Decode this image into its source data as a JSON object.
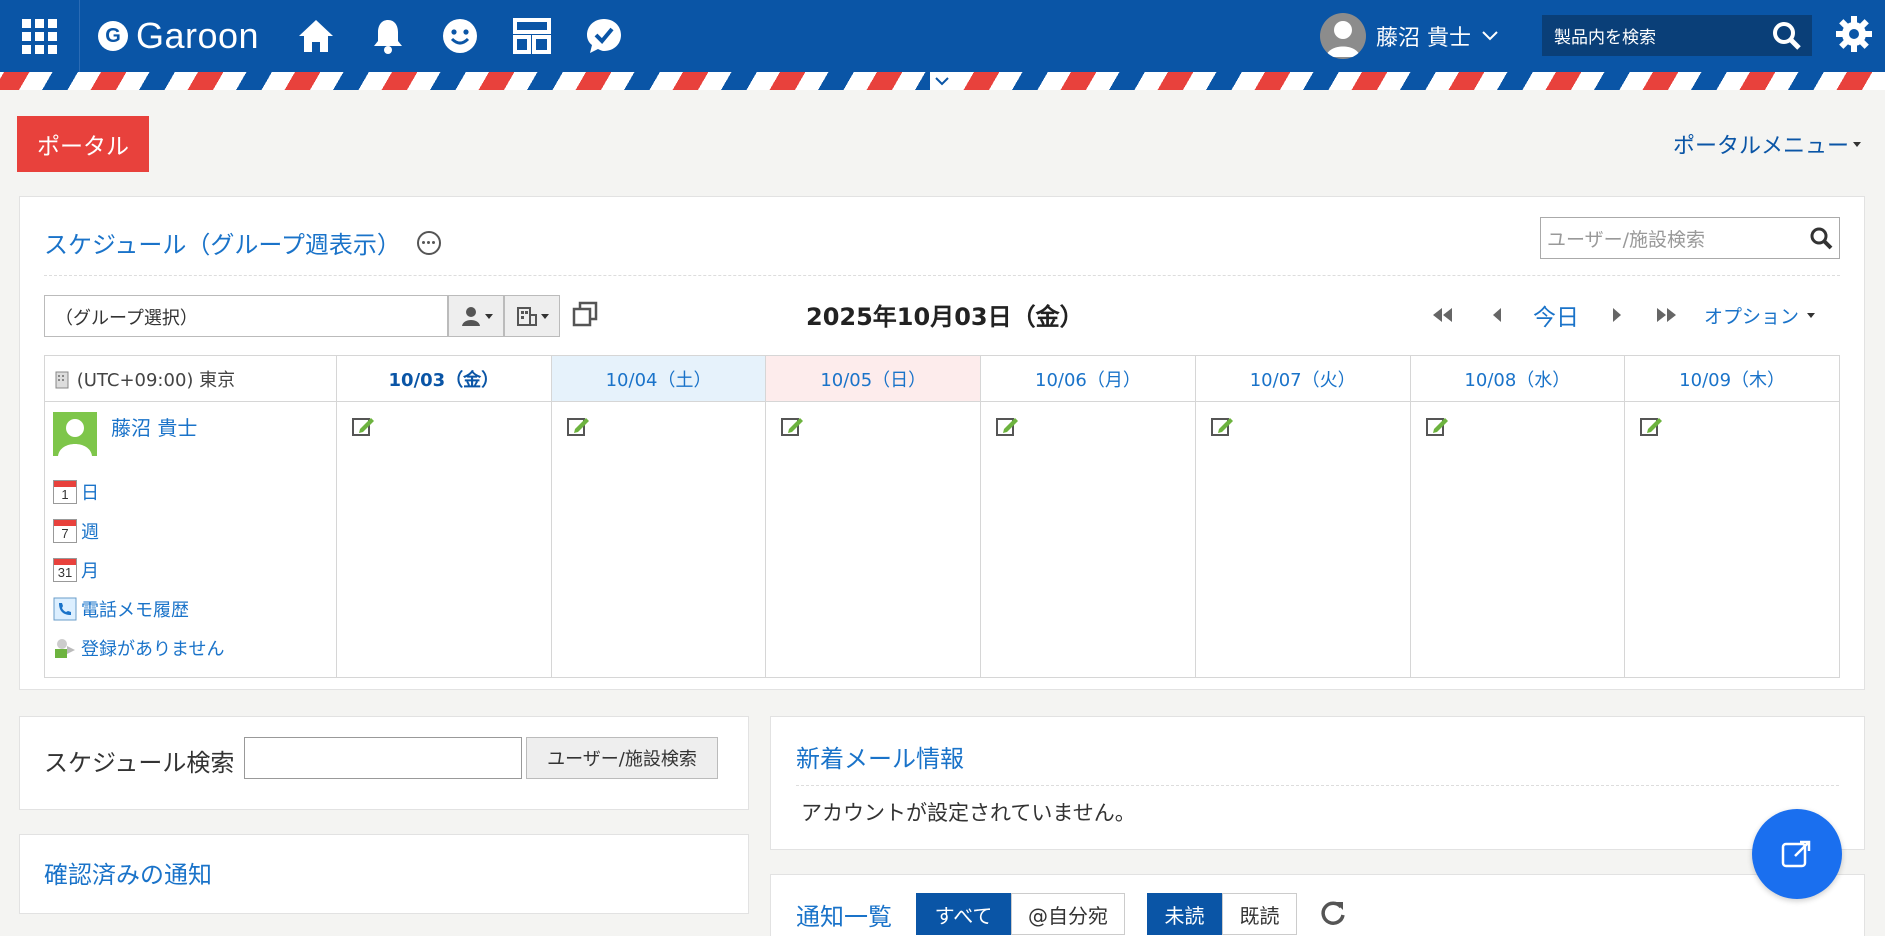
{
  "header": {
    "logo_letter": "G",
    "app_name": "Garoon",
    "user_name": "藤沼 貴士",
    "search_placeholder": "製品内を検索"
  },
  "page": {
    "portal_tag": "ポータル",
    "portal_menu": "ポータルメニュー"
  },
  "schedule": {
    "title": "スケジュール（グループ週表示）",
    "user_search_placeholder": "ユーザー/施設検索",
    "group_select": "（グループ選択）",
    "current_date": "2025年10月03日（金）",
    "today_label": "今日",
    "option_label": "オプション",
    "timezone": "(UTC+09:00) 東京",
    "days": [
      {
        "label": "10/03（金）",
        "type": "current"
      },
      {
        "label": "10/04（土）",
        "type": "sat"
      },
      {
        "label": "10/05（日）",
        "type": "sun"
      },
      {
        "label": "10/06（月）",
        "type": "normal"
      },
      {
        "label": "10/07（火）",
        "type": "normal"
      },
      {
        "label": "10/08（水）",
        "type": "normal"
      },
      {
        "label": "10/09（木）",
        "type": "normal"
      }
    ],
    "user": {
      "name": "藤沼 貴士",
      "links": {
        "day": "日",
        "week": "週",
        "month": "月",
        "phone_memo": "電話メモ履歴",
        "no_registration": "登録がありません"
      },
      "cal_icon_numbers": {
        "day": "1",
        "week": "7",
        "month": "31"
      }
    }
  },
  "schedule_search": {
    "label": "スケジュール検索",
    "value": "",
    "button": "ユーザー/施設検索"
  },
  "confirmed_notifications": {
    "title": "確認済みの通知"
  },
  "new_mail": {
    "title": "新着メール情報",
    "message": "アカウントが設定されていません。"
  },
  "notifications": {
    "title": "通知一覧",
    "filter_all": "すべて",
    "filter_mine": "@自分宛",
    "filter_unread": "未読",
    "filter_read": "既読"
  },
  "colors": {
    "header_blue": "#0a55a6",
    "accent_red": "#e8413c",
    "link_blue": "#1a73c9",
    "fab_blue": "#1a6fef"
  }
}
